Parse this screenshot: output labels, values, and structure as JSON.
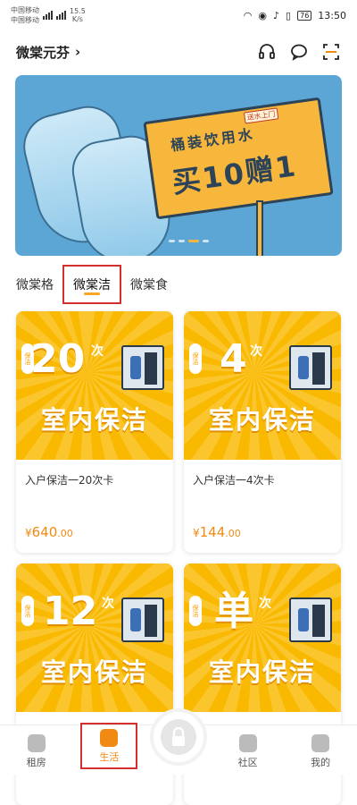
{
  "status_bar": {
    "carrier1": "中国移动",
    "carrier2": "中国移动",
    "net_speed": "15.5",
    "net_unit": "K/s",
    "battery": "76",
    "time": "13:50"
  },
  "header": {
    "title": "微棠元芬",
    "chevron": "›"
  },
  "banner": {
    "tag": "送水上门",
    "line1": "桶装饮用水",
    "line2": "买10赠1"
  },
  "tabs": [
    {
      "label": "微棠格",
      "active": false
    },
    {
      "label": "微棠洁",
      "active": true
    },
    {
      "label": "微棠食",
      "active": false
    }
  ],
  "products": [
    {
      "count": "20",
      "unit": "次",
      "title": "室内保洁",
      "name": "入户保洁一20次卡",
      "currency": "¥",
      "price_int": "640",
      "price_dec": ".00",
      "seal": "保洁"
    },
    {
      "count": "4",
      "unit": "次",
      "title": "室内保洁",
      "name": "入户保洁一4次卡",
      "currency": "¥",
      "price_int": "144",
      "price_dec": ".00",
      "seal": "保洁"
    },
    {
      "count": "12",
      "unit": "次",
      "title": "室内保洁",
      "name": "",
      "currency": "",
      "price_int": "",
      "price_dec": "",
      "seal": "保洁"
    },
    {
      "count": "单",
      "unit": "次",
      "title": "室内保洁",
      "name": "",
      "currency": "",
      "price_int": "",
      "price_dec": "",
      "seal": "保洁"
    }
  ],
  "tabbar": [
    {
      "label": "租房"
    },
    {
      "label": "生活"
    },
    {
      "label": "社区"
    },
    {
      "label": "我的"
    }
  ],
  "colors": {
    "accent": "#f08a13",
    "card_bg": "#f8b900",
    "highlight": "#d32f2f"
  }
}
